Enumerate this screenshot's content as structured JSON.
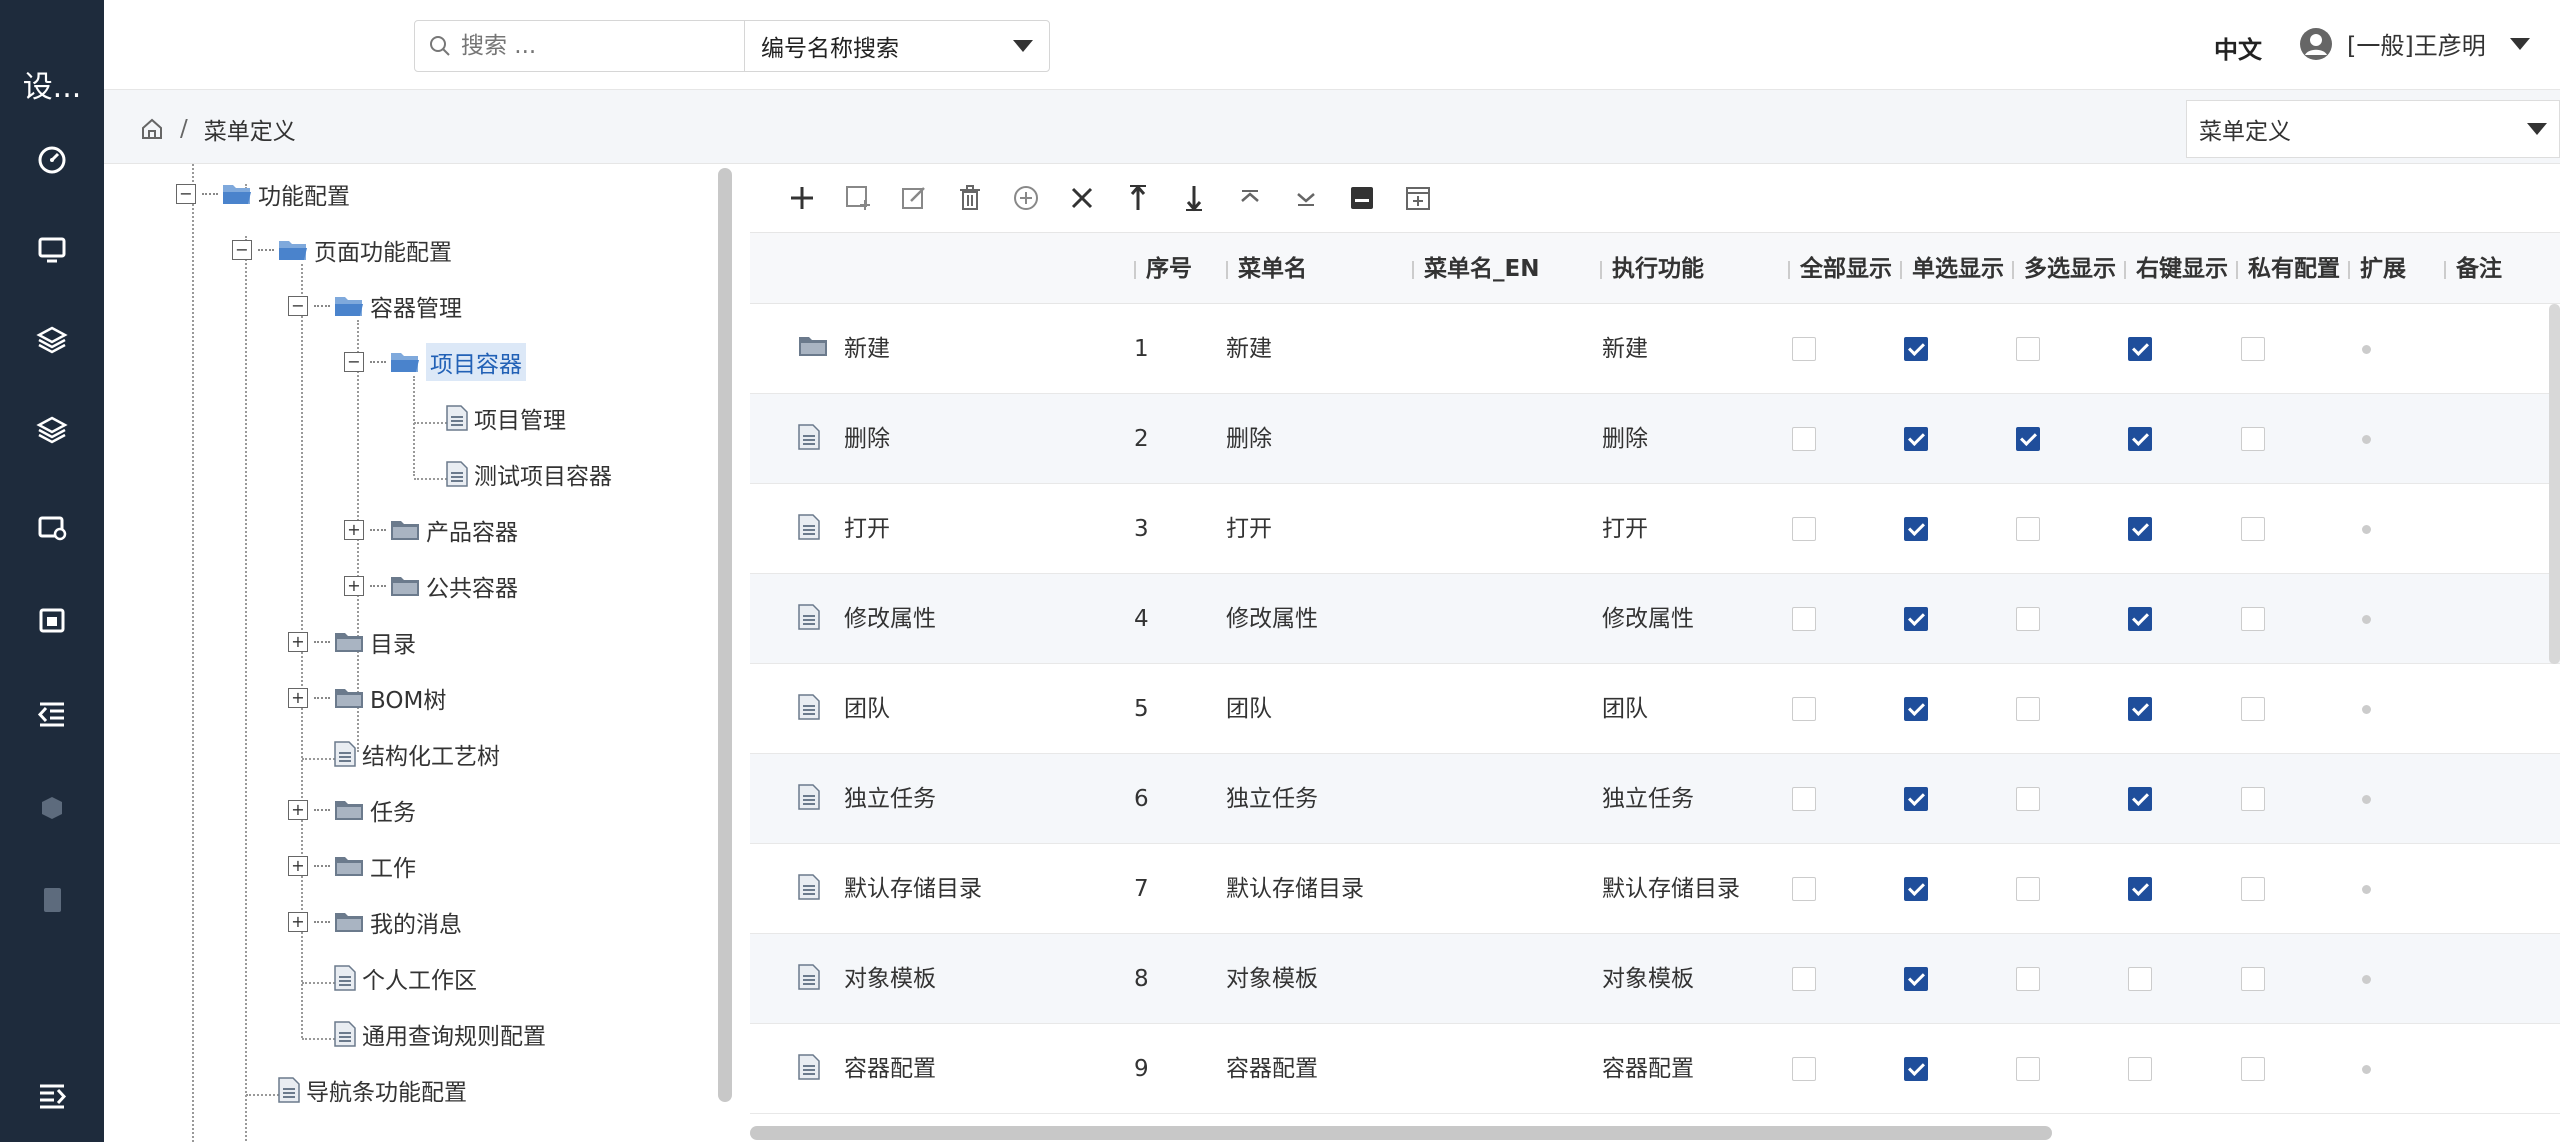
{
  "sidebar": {
    "brand": "设...",
    "items": [
      "dashboard-icon",
      "monitor-icon",
      "layers-icon",
      "layers-alt-icon",
      "settings-screen-icon",
      "calendar-icon",
      "indent-icon",
      "cube-icon",
      "tablet-icon"
    ],
    "collapse": "menu-collapse-icon"
  },
  "header": {
    "search_placeholder": "搜索 ...",
    "search_type": "编号名称搜索",
    "lang": "中文",
    "user": "[一般]王彦明"
  },
  "breadcrumb": {
    "current": "菜单定义",
    "select_value": "菜单定义"
  },
  "tree": {
    "nodes": [
      {
        "label": "功能配置",
        "type": "folder",
        "toggle": "−"
      },
      {
        "label": "页面功能配置",
        "type": "folder",
        "toggle": "−"
      },
      {
        "label": "容器管理",
        "type": "folder",
        "toggle": "−"
      },
      {
        "label": "项目容器",
        "type": "folder",
        "toggle": "−",
        "selected": true
      },
      {
        "label": "项目管理",
        "type": "file"
      },
      {
        "label": "测试项目容器",
        "type": "file"
      },
      {
        "label": "产品容器",
        "type": "folder",
        "toggle": "+"
      },
      {
        "label": "公共容器",
        "type": "folder",
        "toggle": "+"
      },
      {
        "label": "目录",
        "type": "folder",
        "toggle": "+"
      },
      {
        "label": "BOM树",
        "type": "folder",
        "toggle": "+"
      },
      {
        "label": "结构化工艺树",
        "type": "file"
      },
      {
        "label": "任务",
        "type": "folder",
        "toggle": "+"
      },
      {
        "label": "工作",
        "type": "folder",
        "toggle": "+"
      },
      {
        "label": "我的消息",
        "type": "folder",
        "toggle": "+"
      },
      {
        "label": "个人工作区",
        "type": "file"
      },
      {
        "label": "通用查询规则配置",
        "type": "file"
      },
      {
        "label": "导航条功能配置",
        "type": "file"
      }
    ]
  },
  "toolbar": [
    "add-icon",
    "add-child-icon",
    "edit-icon",
    "delete-icon",
    "add-circle-icon",
    "close-icon",
    "move-up-icon",
    "move-down-icon",
    "collapse-up-icon",
    "expand-down-icon",
    "save-icon",
    "insert-icon"
  ],
  "table": {
    "columns": [
      "序号",
      "菜单名",
      "菜单名_EN",
      "执行功能",
      "全部显示",
      "单选显示",
      "多选显示",
      "右键显示",
      "私有配置",
      "扩展",
      "备注"
    ],
    "rows": [
      {
        "name": "新建",
        "seq": "1",
        "menu": "新建",
        "func": "新建",
        "icon": "folder",
        "all": false,
        "single": true,
        "multi": false,
        "right": true,
        "private": false
      },
      {
        "name": "删除",
        "seq": "2",
        "menu": "删除",
        "func": "删除",
        "icon": "file",
        "all": false,
        "single": true,
        "multi": true,
        "right": true,
        "private": false
      },
      {
        "name": "打开",
        "seq": "3",
        "menu": "打开",
        "func": "打开",
        "icon": "file",
        "all": false,
        "single": true,
        "multi": false,
        "right": true,
        "private": false
      },
      {
        "name": "修改属性",
        "seq": "4",
        "menu": "修改属性",
        "func": "修改属性",
        "icon": "file",
        "all": false,
        "single": true,
        "multi": false,
        "right": true,
        "private": false
      },
      {
        "name": "团队",
        "seq": "5",
        "menu": "团队",
        "func": "团队",
        "icon": "file",
        "all": false,
        "single": true,
        "multi": false,
        "right": true,
        "private": false
      },
      {
        "name": "独立任务",
        "seq": "6",
        "menu": "独立任务",
        "func": "独立任务",
        "icon": "file",
        "all": false,
        "single": true,
        "multi": false,
        "right": true,
        "private": false
      },
      {
        "name": "默认存储目录",
        "seq": "7",
        "menu": "默认存储目录",
        "func": "默认存储目录",
        "icon": "file",
        "all": false,
        "single": true,
        "multi": false,
        "right": true,
        "private": false
      },
      {
        "name": "对象模板",
        "seq": "8",
        "menu": "对象模板",
        "func": "对象模板",
        "icon": "file",
        "all": false,
        "single": true,
        "multi": false,
        "right": false,
        "private": false
      },
      {
        "name": "容器配置",
        "seq": "9",
        "menu": "容器配置",
        "func": "容器配置",
        "icon": "file",
        "all": false,
        "single": true,
        "multi": false,
        "right": false,
        "private": false
      }
    ]
  }
}
